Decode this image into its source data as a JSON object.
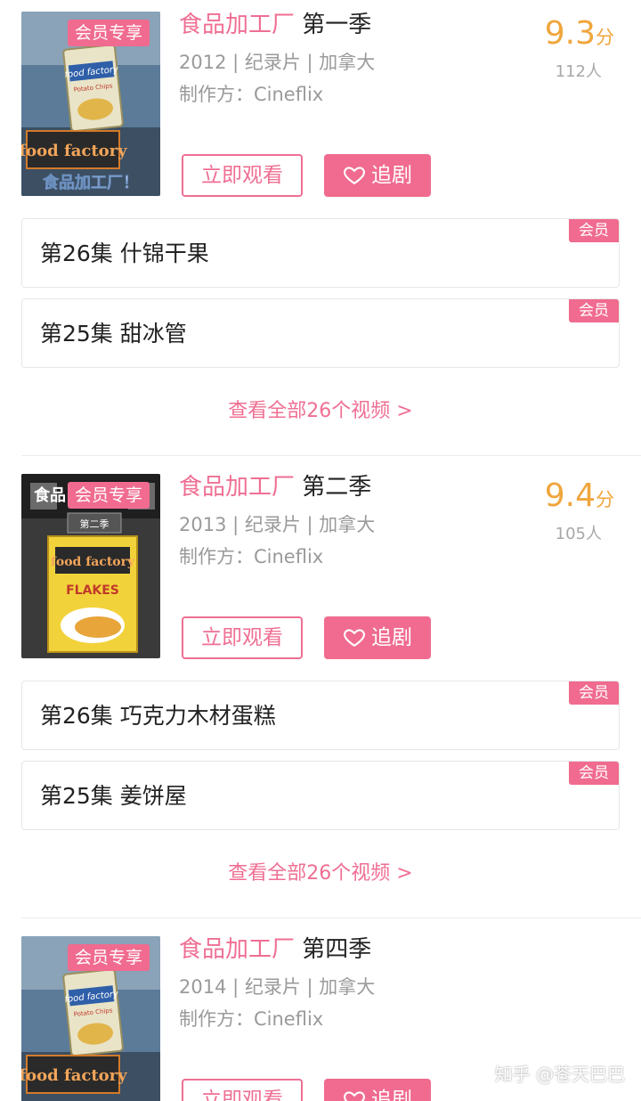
{
  "seasons": [
    {
      "vip_tag": "会员专享",
      "title_pink": "食品加工厂",
      "title_season": "第一季",
      "year_country": "2012 | 纪录片 | 加拿大",
      "maker": "制作方：Cineflix",
      "score_num": "9.3",
      "score_unit": "分",
      "voters": "112人",
      "watch_label": "立即观看",
      "follow_label": "追剧",
      "episodes": [
        {
          "title": "第26集 什锦干果",
          "badge": "会员"
        },
        {
          "title": "第25集 甜冰管",
          "badge": "会员"
        }
      ],
      "view_all": "查看全部26个视频 >",
      "poster": {
        "box_brand": "food factory",
        "box_sub": "Potato Chips",
        "logo": "food factory",
        "cn_caption": "食品加工厂！",
        "box_color": "#e9e4c8"
      }
    },
    {
      "vip_tag": "会员专享",
      "title_pink": "食品加工厂",
      "title_season": "第二季",
      "year_country": "2013 | 纪录片 | 加拿大",
      "maker": "制作方：Cineflix",
      "score_num": "9.4",
      "score_unit": "分",
      "voters": "105人",
      "watch_label": "立即观看",
      "follow_label": "追剧",
      "episodes": [
        {
          "title": "第26集 巧克力木材蛋糕",
          "badge": "会员"
        },
        {
          "title": "第25集 姜饼屋",
          "badge": "会员"
        }
      ],
      "view_all": "查看全部26个视频 >",
      "poster": {
        "box_brand": "food factory",
        "box_sub": "FLAKES",
        "season_plate": "第二季",
        "cn_caption": "食品",
        "box_color": "#f2d23a"
      }
    },
    {
      "vip_tag": "会员专享",
      "title_pink": "食品加工厂",
      "title_season": "第四季",
      "year_country": "2014 | 纪录片 | 加拿大",
      "maker": "制作方：Cineflix",
      "watch_label": "立即观看",
      "follow_label": "追剧",
      "poster": {
        "box_brand": "food factory",
        "box_sub": "Potato Chips",
        "logo": "food factory",
        "box_color": "#e9e4c8"
      }
    }
  ],
  "watermark": "知乎 @苍天巴巴",
  "colors": {
    "accent_pink": "#f06b8f",
    "score_orange": "#f0a53c",
    "meta_gray": "#9a9a9a"
  },
  "icons": [
    "heart-icon"
  ]
}
